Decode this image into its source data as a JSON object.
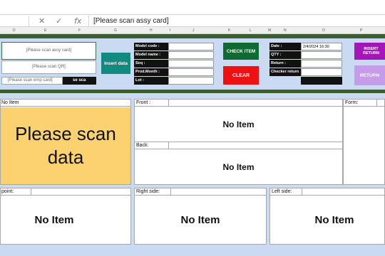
{
  "formula_bar": {
    "cell_content": "[Please scan assy card]",
    "fx_label": "fx",
    "cancel_icon": "close-icon",
    "enter_icon": "check-icon"
  },
  "columns": [
    "D",
    "E",
    "F",
    "G",
    "H",
    "I",
    "J",
    "K",
    "L",
    "M",
    "N",
    "O",
    "P"
  ],
  "scan_panel": {
    "assy_card": "[Please scan assy card]",
    "qr": "[Please scan QR]",
    "emp_card": "[Please scan emp card]",
    "emp_value": "se sca"
  },
  "insert_button": "Insert data",
  "fields": {
    "model_code": "Model code :",
    "model_name": "Model name :",
    "seq": "Seq :",
    "prod_month": "Prod.Month :",
    "lot": "Lot :"
  },
  "check_button": "CHECK ITEM",
  "clear_button": "CLEAR",
  "return_fields": {
    "date_label": "Date :",
    "date_value": "2/4/2024 16:30",
    "qty": "QTY :",
    "return_label": "Return :",
    "checker": "Checker return :"
  },
  "insert_return_button": "INSERT RETURN",
  "return_button": "RETURN",
  "sections": {
    "no_item_header": "No Item",
    "big_message": "Please scan data",
    "front_label": "Front :",
    "back_label": "Back:",
    "form_label": "Form:",
    "point_label": "point:",
    "right_label": "Right side:",
    "left_label": "Left side:",
    "no_item": "No Item"
  },
  "colors": {
    "panel_bg": "#c9daf2",
    "frame_green": "#3d5e35",
    "insert_btn": "#138a7f",
    "check_btn": "#0f6b33",
    "clear_btn": "#ee1111",
    "insert_return_btn": "#a516b8",
    "return_btn": "#c59bea",
    "message_bg": "#fcd270"
  }
}
